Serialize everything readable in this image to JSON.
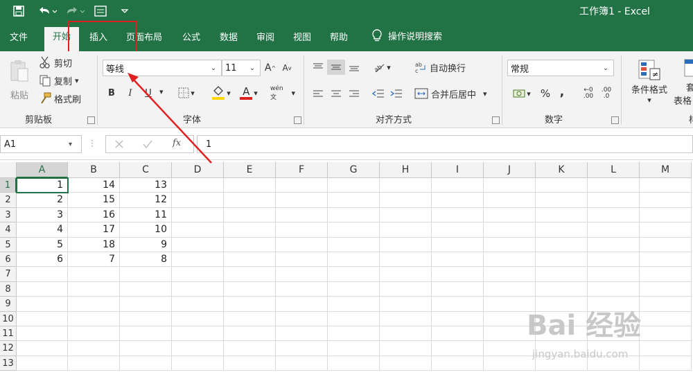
{
  "window": {
    "title": "工作簿1 - Excel"
  },
  "tabs": [
    {
      "label": "文件"
    },
    {
      "label": "开始"
    },
    {
      "label": "插入"
    },
    {
      "label": "页面布局"
    },
    {
      "label": "公式"
    },
    {
      "label": "数据"
    },
    {
      "label": "审阅"
    },
    {
      "label": "视图"
    },
    {
      "label": "帮助"
    }
  ],
  "tell_me": "操作说明搜索",
  "clipboard": {
    "paste": "粘贴",
    "cut": "剪切",
    "copy": "复制",
    "format_painter": "格式刷",
    "group": "剪贴板"
  },
  "font": {
    "name": "等线",
    "size": "11",
    "group": "字体",
    "bold": "B",
    "italic": "I",
    "underline": "U",
    "grow": "A",
    "shrink": "A",
    "color": "A",
    "phonetic": "wén 文"
  },
  "alignment": {
    "wrap": "自动换行",
    "merge": "合并后居中",
    "group": "对齐方式"
  },
  "number": {
    "format": "常规",
    "percent": "%",
    "comma": ",",
    "group": "数字",
    "inc_decimal": ".00",
    "dec_decimal": ".0"
  },
  "styles": {
    "conditional": "条件格式",
    "table_line1": "套",
    "table_line2": "表格",
    "group_cut": "样"
  },
  "formula_bar": {
    "name_box": "A1",
    "fx": "fx",
    "value": "1"
  },
  "columns": [
    "A",
    "B",
    "C",
    "D",
    "E",
    "F",
    "G",
    "H",
    "I",
    "J",
    "K",
    "L",
    "M"
  ],
  "rows": [
    "1",
    "2",
    "3",
    "4",
    "5",
    "6",
    "7",
    "8",
    "9",
    "10",
    "11",
    "12",
    "13"
  ],
  "cells": {
    "A": [
      "1",
      "2",
      "3",
      "4",
      "5",
      "6"
    ],
    "B": [
      "14",
      "15",
      "16",
      "17",
      "18",
      "7"
    ],
    "C": [
      "13",
      "12",
      "11",
      "10",
      "9",
      "8"
    ]
  },
  "watermark": {
    "main": "Bai 经验",
    "sub": "jingyan.baidu.com"
  },
  "colors": {
    "accent": "#217346",
    "annotation": "#e02020"
  }
}
